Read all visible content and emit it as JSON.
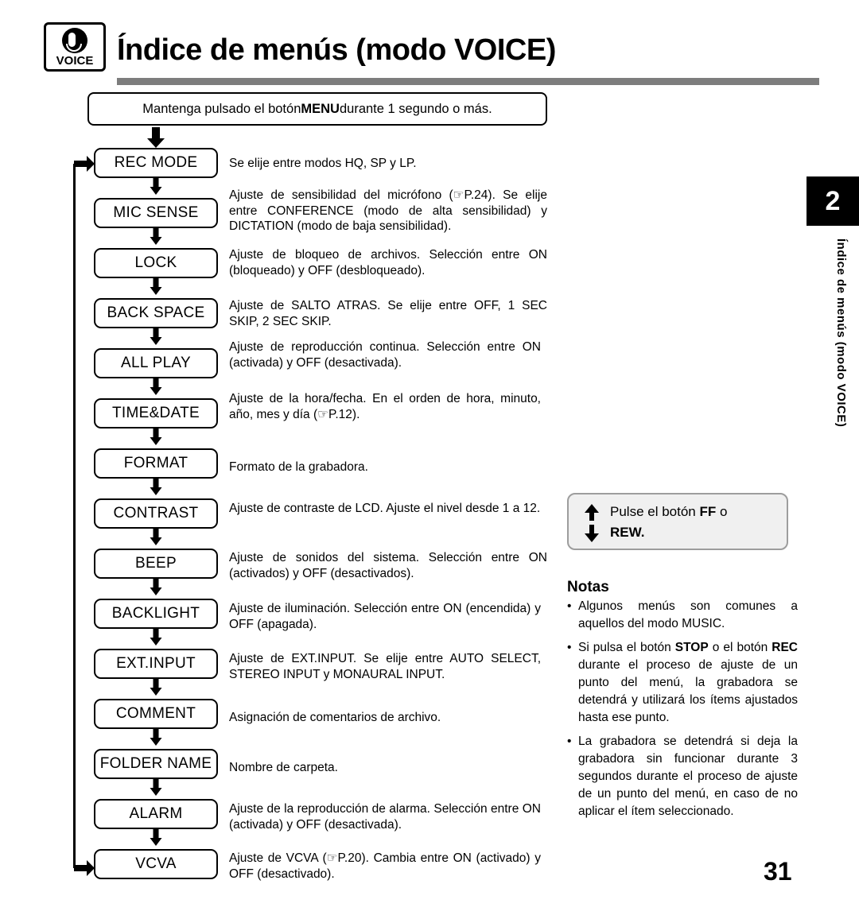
{
  "header": {
    "badge_label": "VOICE",
    "badge_icon": "microphone-icon",
    "title": "Índice de menús  (modo VOICE)"
  },
  "chapter": {
    "number": "2",
    "vertical_label": "Índice de menús (modo VOICE)"
  },
  "intro": {
    "text_before": "Mantenga pulsado el botón ",
    "bold": "MENU",
    "text_after": " durante 1 segundo o más."
  },
  "flow": [
    {
      "label": "REC MODE",
      "desc": "Se elije entre  modos HQ, SP y LP."
    },
    {
      "label": "MIC SENSE",
      "desc": "Ajuste de sensibilidad del micrófono (☞P.24). Se elije entre CONFERENCE (modo de alta sensibilidad) y DICTATION (modo de baja sensibilidad)."
    },
    {
      "label": "LOCK",
      "desc": "Ajuste de bloqueo de archivos. Selección entre ON (bloqueado) y OFF (desbloqueado)."
    },
    {
      "label": "BACK SPACE",
      "desc": "Ajuste de SALTO ATRAS. Se elije entre OFF, 1 SEC SKIP, 2 SEC SKIP."
    },
    {
      "label": "ALL PLAY",
      "desc": "Ajuste de reproducción continua. Selección entre ON (activada) y OFF (desactivada)."
    },
    {
      "label": "TIME&DATE",
      "desc": "Ajuste de la hora/fecha. En el orden de hora, minuto, año, mes y día (☞P.12)."
    },
    {
      "label": "FORMAT",
      "desc": "Formato de la grabadora."
    },
    {
      "label": "CONTRAST",
      "desc": "Ajuste de contraste de LCD. Ajuste el nivel desde 1 a 12."
    },
    {
      "label": "BEEP",
      "desc": "Ajuste de sonidos del sistema. Selección entre ON (activados) y OFF (desactivados)."
    },
    {
      "label": "BACKLIGHT",
      "desc": "Ajuste de iluminación. Selección entre ON (encendida) y OFF (apagada)."
    },
    {
      "label": "EXT.INPUT",
      "desc": "Ajuste de EXT.INPUT. Se elije entre AUTO SELECT, STEREO INPUT y MONAURAL INPUT."
    },
    {
      "label": "COMMENT",
      "desc": "Asignación de comentarios de archivo."
    },
    {
      "label": "FOLDER NAME",
      "desc": "Nombre de carpeta."
    },
    {
      "label": "ALARM",
      "desc": "Ajuste de la reproducción de alarma. Selección entre ON (activada) y OFF (desactivada)."
    },
    {
      "label": "VCVA",
      "desc": "Ajuste de VCVA (☞P.20). Cambia entre ON (activado) y OFF (desactivado)."
    }
  ],
  "press_box": {
    "line1_before": "Pulse el botón ",
    "line1_bold": "FF",
    "line1_after": " o",
    "line2": "REW."
  },
  "notes": {
    "title": "Notas",
    "items": [
      {
        "parts": [
          {
            "t": "Algunos menús son comunes a aquellos del modo MUSIC."
          }
        ]
      },
      {
        "parts": [
          {
            "t": "Si pulsa el botón "
          },
          {
            "t": "STOP",
            "b": true
          },
          {
            "t": " o el botón "
          },
          {
            "t": "REC",
            "b": true
          },
          {
            "t": " durante el proceso de ajuste de un punto del menú, la grabadora se detendrá y utilizará los ítems ajustados hasta ese punto."
          }
        ]
      },
      {
        "parts": [
          {
            "t": "La grabadora se detendrá si deja la grabadora sin funcionar durante 3 segundos durante el proceso de ajuste de un punto del menú, en caso de no aplicar el ítem seleccionado."
          }
        ]
      }
    ]
  },
  "page_number": "31"
}
